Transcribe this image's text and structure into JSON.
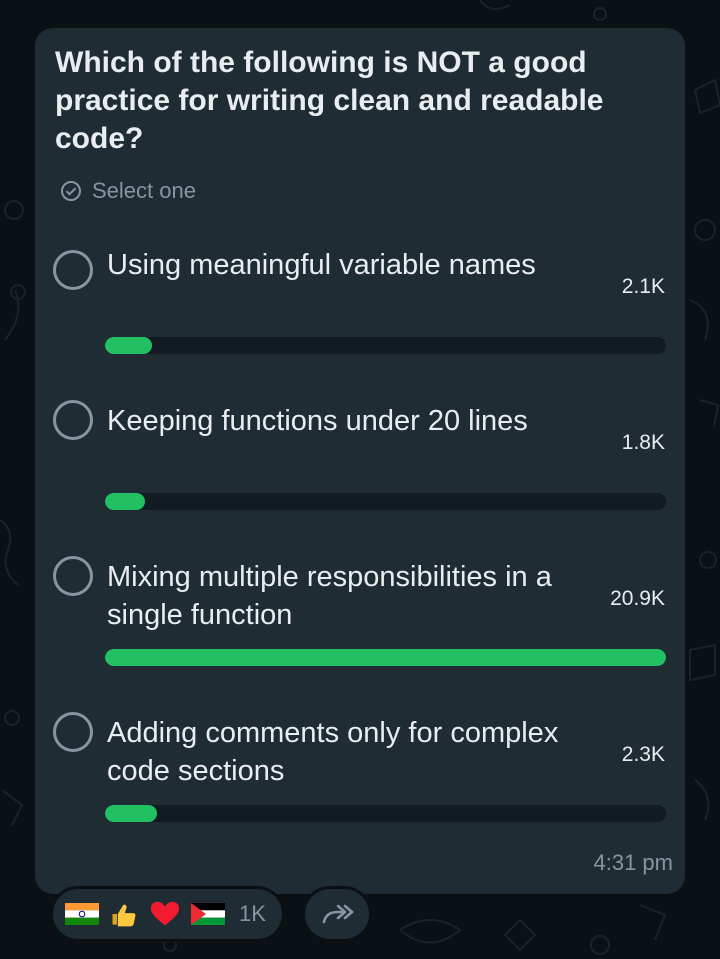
{
  "poll": {
    "question": "Which of the following is NOT a good practice for writing clean and readable code?",
    "select_hint": "Select one",
    "options": [
      {
        "text": "Using meaningful variable names",
        "count": "2.1K",
        "fraction": 0.084
      },
      {
        "text": "Keeping functions under 20 lines",
        "count": "1.8K",
        "fraction": 0.072
      },
      {
        "text": "Mixing multiple responsibilities in a single function",
        "count": "20.9K",
        "fraction": 1.0
      },
      {
        "text": "Adding comments only for complex code sections",
        "count": "2.3K",
        "fraction": 0.092
      }
    ],
    "time": "4:31 pm"
  },
  "reactions": {
    "emojis": [
      "india-flag-icon",
      "thumbs-up-icon",
      "red-heart-icon",
      "palestine-flag-icon"
    ],
    "count": "1K"
  },
  "colors": {
    "background": "#0b1014",
    "bubble": "#1f2c34",
    "accent": "#21c063",
    "text": "#e9edef",
    "muted": "#8696a0"
  }
}
